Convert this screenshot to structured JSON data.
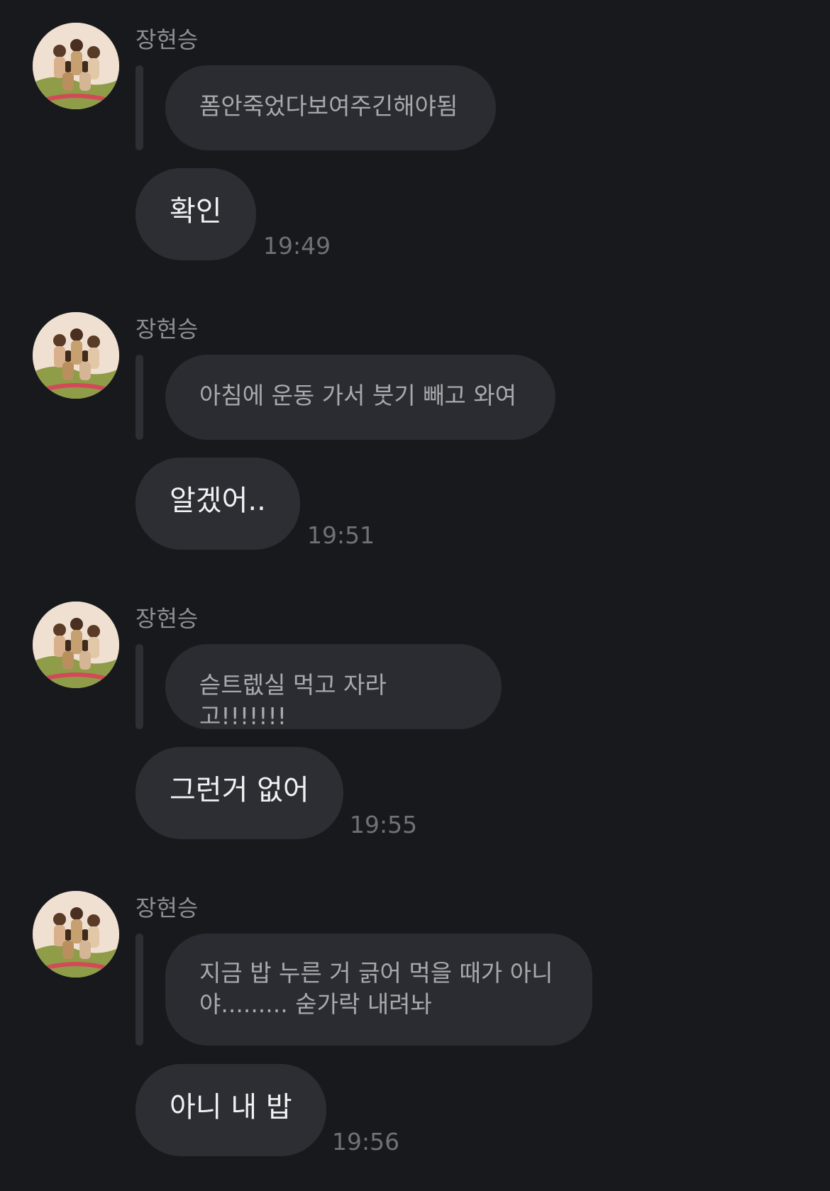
{
  "messages": [
    {
      "sender": "장현승",
      "quote": "폼안죽었다보여주긴해야됨",
      "reply": "확인",
      "time": "19:49"
    },
    {
      "sender": "장현승",
      "quote": "아침에 운동 가서 붓기 빼고 와여",
      "reply": "알겠어..",
      "time": "19:51"
    },
    {
      "sender": "장현승",
      "quote": "슫트렚실 먹고 자라고!!!!!!!",
      "reply": "그런거 없어",
      "time": "19:55"
    },
    {
      "sender": "장현승",
      "quote_line1": "지금 밥 누른 거 긁어 먹을 때가 아니",
      "quote_line2": "야......... 숟가락 내려놔",
      "reply": "아니 내 밥",
      "time": "19:56"
    }
  ],
  "colors": {
    "background": "#18191d",
    "bubble": "#2d2e33",
    "quote_bubble": "#2b2c31",
    "reply_bar": "#2e2f34",
    "sender_text": "#8e8f94",
    "time_text": "#707176"
  }
}
